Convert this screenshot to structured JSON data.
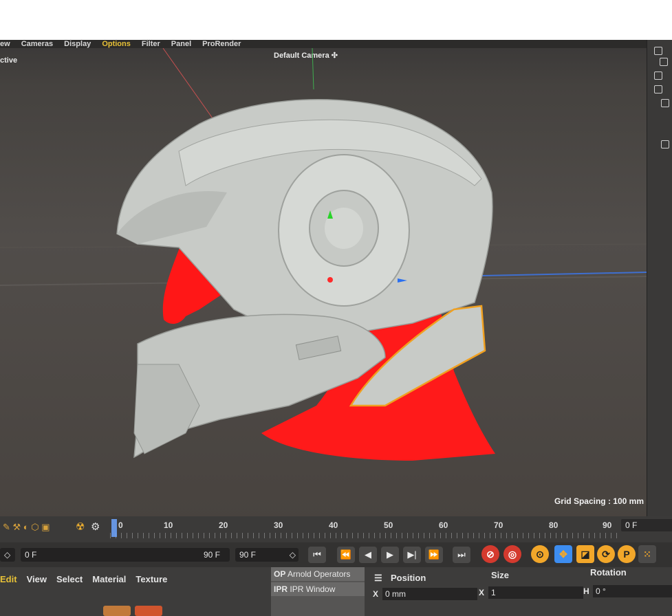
{
  "menubar": {
    "items": [
      "ew",
      "Cameras",
      "Display",
      "Options",
      "Filter",
      "Panel",
      "ProRender"
    ],
    "highlighted": "Options"
  },
  "viewport": {
    "projection_label": "ctive",
    "camera_label": "Default Camera",
    "grid_spacing": "Grid Spacing : 100 mm",
    "colors": {
      "helmet": "#c9ccc8",
      "head": "#ff1a1a",
      "selection": "#f0a020"
    }
  },
  "timeline": {
    "ticks": [
      "0",
      "10",
      "20",
      "30",
      "40",
      "50",
      "60",
      "70",
      "80",
      "90"
    ],
    "end_frame_field": "0 F"
  },
  "transport": {
    "start_field": "0 F",
    "range_end": "90 F",
    "end_field": "90 F",
    "buttons": [
      "go-start",
      "prev-key",
      "prev-frame",
      "play",
      "next-frame",
      "next-key",
      "go-end"
    ]
  },
  "materials": {
    "menu": [
      "Edit",
      "View",
      "Select",
      "Material",
      "Texture"
    ],
    "highlighted": "Edit"
  },
  "render_list": {
    "items": [
      {
        "badge": "OP",
        "label": "Arnold Operators"
      },
      {
        "badge": "IPR",
        "label": "IPR Window"
      }
    ]
  },
  "coordinates": {
    "position_header": "Position",
    "size_header": "Size",
    "rotation_header": "Rotation",
    "row1": {
      "axis": "X",
      "position": "0 mm",
      "size_axis": "X",
      "size": "1",
      "rot_axis": "H",
      "rotation": "0 °"
    }
  }
}
